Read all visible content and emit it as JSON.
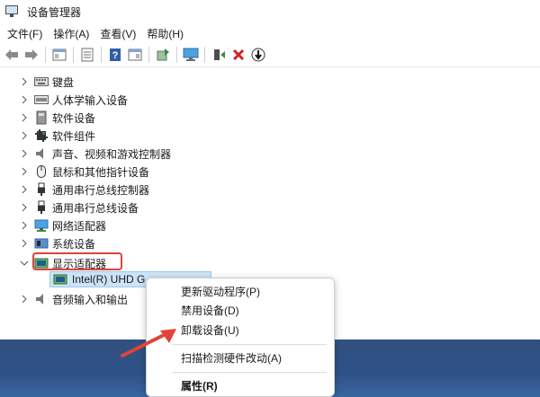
{
  "window": {
    "title": "设备管理器"
  },
  "menubar": [
    "文件(F)",
    "操作(A)",
    "查看(V)",
    "帮助(H)"
  ],
  "tree_items": [
    {
      "label": "键盘",
      "icon": "keyboard-icon"
    },
    {
      "label": "人体学输入设备",
      "icon": "hid-icon"
    },
    {
      "label": "软件设备",
      "icon": "software-device-icon"
    },
    {
      "label": "软件组件",
      "icon": "software-component-icon"
    },
    {
      "label": "声音、视频和游戏控制器",
      "icon": "speaker-icon"
    },
    {
      "label": "鼠标和其他指针设备",
      "icon": "mouse-icon"
    },
    {
      "label": "通用串行总线控制器",
      "icon": "usb-icon"
    },
    {
      "label": "通用串行总线设备",
      "icon": "usb-icon"
    },
    {
      "label": "网络适配器",
      "icon": "network-icon"
    },
    {
      "label": "系统设备",
      "icon": "system-icon"
    },
    {
      "label": "显示适配器",
      "icon": "display-adapter-icon",
      "expanded": true
    },
    {
      "label": "音频输入和输出",
      "icon": "audio-icon"
    }
  ],
  "selected_device": {
    "label": "Intel(R) UHD G",
    "icon": "display-adapter-icon"
  },
  "context_menu": {
    "items": [
      {
        "label": "更新驱动程序(P)"
      },
      {
        "label": "禁用设备(D)"
      },
      {
        "label": "卸载设备(U)"
      },
      {
        "label": "扫描检测硬件改动(A)"
      },
      {
        "label": "属性(R)",
        "bold": true
      }
    ]
  },
  "colors": {
    "highlight": "#e0433a",
    "selection": "#cce4f7",
    "accent": "#2f6fc7"
  }
}
